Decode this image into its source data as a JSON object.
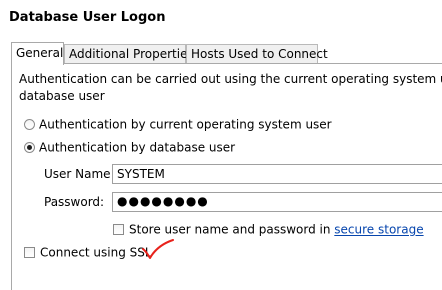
{
  "window": {
    "title": "Database User Logon"
  },
  "tabs": [
    {
      "label": "General",
      "active": true
    },
    {
      "label": "Additional Properties",
      "active": false
    },
    {
      "label": "Hosts Used to Connect",
      "active": false
    }
  ],
  "general": {
    "description_line1": "Authentication can be carried out using the current operating system user or a va",
    "description_line2": "database user",
    "auth_options": [
      {
        "label": "Authentication by current operating system user",
        "checked": false
      },
      {
        "label": "Authentication by database user",
        "checked": true
      }
    ],
    "user_name_label": "User Name:",
    "user_name_value": "SYSTEM",
    "password_label": "Password:",
    "password_value": "●●●●●●●●",
    "store_checkbox_label": "Store user name and password in ",
    "store_checkbox_link": "secure storage",
    "store_checked": false,
    "ssl_label": "Connect using SSL",
    "ssl_checked": false
  },
  "annotation": {
    "checkmark_color": "#e8221b"
  }
}
